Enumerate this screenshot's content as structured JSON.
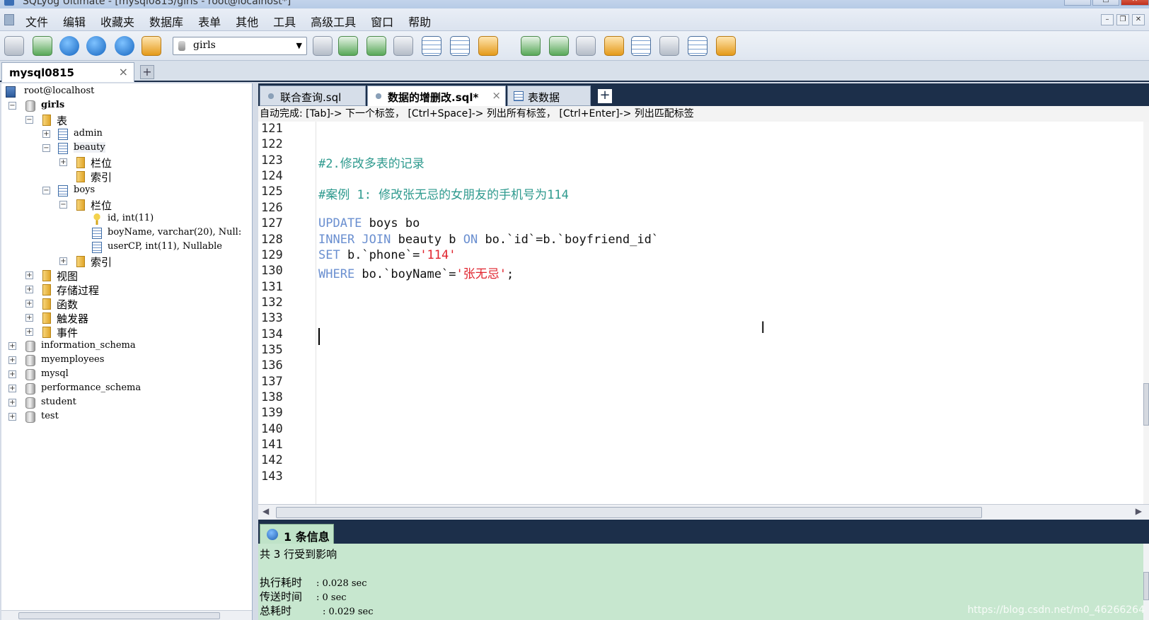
{
  "window": {
    "title": "SQLyog Ultimate - [mysql0815/girls - root@localhost*]"
  },
  "menu": [
    "文件",
    "编辑",
    "收藏夹",
    "数据库",
    "表单",
    "其他",
    "工具",
    "高级工具",
    "窗口",
    "帮助"
  ],
  "toolbar": {
    "database_value": "girls"
  },
  "connection_tab": {
    "label": "mysql0815",
    "close": "×",
    "add": "+"
  },
  "tree": {
    "root": "root@localhost",
    "db_girls": "girls",
    "folder_tables": "表",
    "table_admin": "admin",
    "table_beauty": "beauty",
    "folder_columns": "栏位",
    "folder_index": "索引",
    "table_boys": "boys",
    "col_id": "id, int(11)",
    "col_boyname": "boyName, varchar(20), Null:",
    "col_usercp": "userCP, int(11), Nullable",
    "folder_views": "视图",
    "folder_procs": "存储过程",
    "folder_funcs": "函数",
    "folder_triggers": "触发器",
    "folder_events": "事件",
    "db_information_schema": "information_schema",
    "db_myemployees": "myemployees",
    "db_mysql": "mysql",
    "db_performance_schema": "performance_schema",
    "db_student": "student",
    "db_test": "test"
  },
  "query_tabs": {
    "tab1": "联合查询.sql",
    "tab2": "数据的增删改.sql*",
    "tab3": "表数据",
    "close": "×",
    "add": "+"
  },
  "autocomplete_hint": "自动完成: [Tab]-> 下一个标签， [Ctrl+Space]-> 列出所有标签， [Ctrl+Enter]-> 列出匹配标签",
  "editor": {
    "line_numbers": [
      "121",
      "122",
      "123",
      "124",
      "125",
      "126",
      "127",
      "128",
      "129",
      "130",
      "131",
      "132",
      "133",
      "134",
      "135",
      "136",
      "137",
      "138",
      "139",
      "140",
      "141",
      "142",
      "143"
    ],
    "code": {
      "l123": "#2.修改多表的记录",
      "l125": "#案例 1: 修改张无忌的女朋友的手机号为114",
      "l127_kw": "UPDATE",
      "l127_rest": " boys bo",
      "l128_kw1": "INNER JOIN",
      "l128_mid": " beauty b ",
      "l128_kw2": "ON",
      "l128_rest": " bo.`id`=b.`boyfriend_id`",
      "l129_kw": "SET",
      "l129_mid": " b.`phone`=",
      "l129_str": "'114'",
      "l130_kw": "WHERE",
      "l130_mid": " bo.`boyName`=",
      "l130_str": "'张无忌'",
      "l130_end": ";"
    }
  },
  "result": {
    "tab_label": "1 条信息",
    "affected": "共 3 行受到影响",
    "exec_label": "执行耗时",
    "exec_value": ": 0.028 sec",
    "transfer_label": "传送时间",
    "transfer_value": ": 0 sec",
    "total_label": "总耗时",
    "total_value": ": 0.029 sec"
  },
  "watermark": "https://blog.csdn.net/m0_46266264"
}
